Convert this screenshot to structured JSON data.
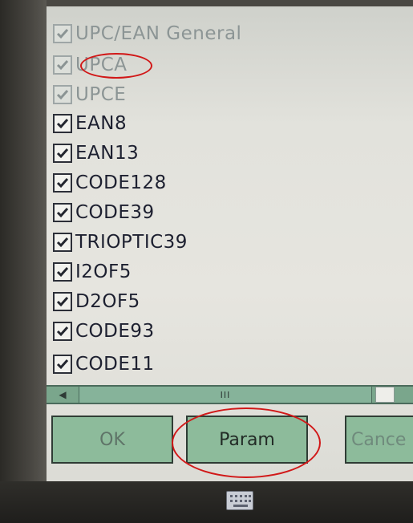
{
  "dialog": {
    "items": [
      {
        "label": "UPC/EAN General",
        "checked": true
      },
      {
        "label": "UPCA",
        "checked": true
      },
      {
        "label": "UPCE",
        "checked": true
      },
      {
        "label": "EAN8",
        "checked": true
      },
      {
        "label": "EAN13",
        "checked": true
      },
      {
        "label": "CODE128",
        "checked": true
      },
      {
        "label": "CODE39",
        "checked": true
      },
      {
        "label": "TRIOPTIC39",
        "checked": true
      },
      {
        "label": "I2OF5",
        "checked": true
      },
      {
        "label": "D2OF5",
        "checked": true
      },
      {
        "label": "CODE93",
        "checked": true
      },
      {
        "label": "CODE11",
        "checked": true
      }
    ],
    "scrollbar": {
      "thumb_grip": "III"
    },
    "buttons": {
      "ok_label": "OK",
      "param_label": "Param",
      "cancel_label": "Cance"
    }
  },
  "taskbar": {
    "keyboard_icon": "keyboard-icon"
  },
  "annotations": {
    "highlight_color": "#d11818"
  }
}
